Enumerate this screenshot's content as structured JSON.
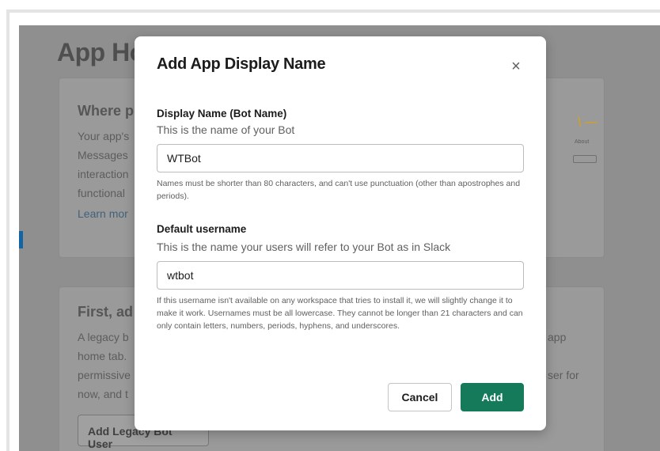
{
  "background": {
    "page_title": "App Ho",
    "card1": {
      "heading": "Where p",
      "lines": [
        "Your app's",
        "Messages",
        "interaction",
        "functional"
      ],
      "link": "Learn mor",
      "illustration_label": "About"
    },
    "card2": {
      "heading": "First, ad",
      "lines": [
        "A legacy b",
        "home tab.",
        "permissive",
        "now, and t"
      ],
      "right_lines": [
        "app",
        "ser for"
      ],
      "button_label": "Add Legacy Bot User"
    }
  },
  "modal": {
    "title": "Add App Display Name",
    "close_symbol": "×",
    "display_name": {
      "label": "Display Name (Bot Name)",
      "description": "This is the name of your Bot",
      "value": "WTBot",
      "help": "Names must be shorter than 80 characters, and can't use punctuation (other than apostrophes and periods)."
    },
    "username": {
      "label": "Default username",
      "description": "This is the name your users will refer to your Bot as in Slack",
      "value": "wtbot",
      "help": "If this username isn't available on any workspace that tries to install it, we will slightly change it to make it work. Usernames must be all lowercase. They cannot be longer than 21 characters and can only contain letters, numbers, periods, hyphens, and underscores."
    },
    "cancel_label": "Cancel",
    "add_label": "Add"
  },
  "colors": {
    "primary": "#147a5a",
    "overlay": "#8f8f8f",
    "text": "#1d1c1d",
    "muted": "#616061"
  }
}
